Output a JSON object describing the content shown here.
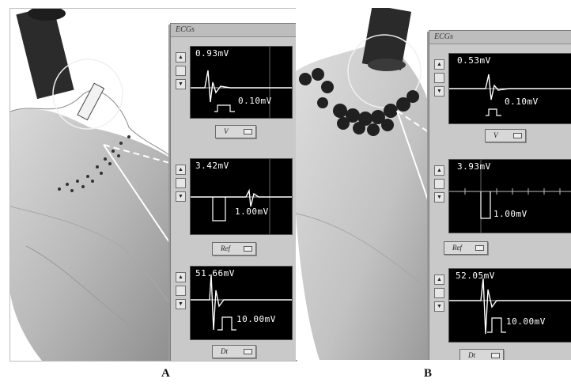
{
  "captions": {
    "a": "A",
    "b": "B"
  },
  "panel_a": {
    "window_title": "ECGs",
    "traces": [
      {
        "top_label": "0.93mV",
        "scale_label": "0.10mV"
      },
      {
        "top_label": "3.42mV",
        "scale_label": "1.00mV"
      },
      {
        "top_label": "51.66mV",
        "scale_label": "10.00mV"
      }
    ],
    "selectors": [
      "V",
      "Ref",
      "Dt"
    ]
  },
  "panel_b": {
    "window_title": "ECGs",
    "traces": [
      {
        "top_label": "0.53mV",
        "scale_label": "0.10mV"
      },
      {
        "top_label": "3.93mV",
        "scale_label": "1.00mV"
      },
      {
        "top_label": "52.05mV",
        "scale_label": "10.00mV"
      }
    ],
    "selectors": [
      "V",
      "Ref",
      "Dt"
    ]
  },
  "controls": {
    "up_glyph": "▲",
    "down_glyph": "▼"
  },
  "icons": [
    "catheter-icon",
    "heart-mesh-icon"
  ]
}
